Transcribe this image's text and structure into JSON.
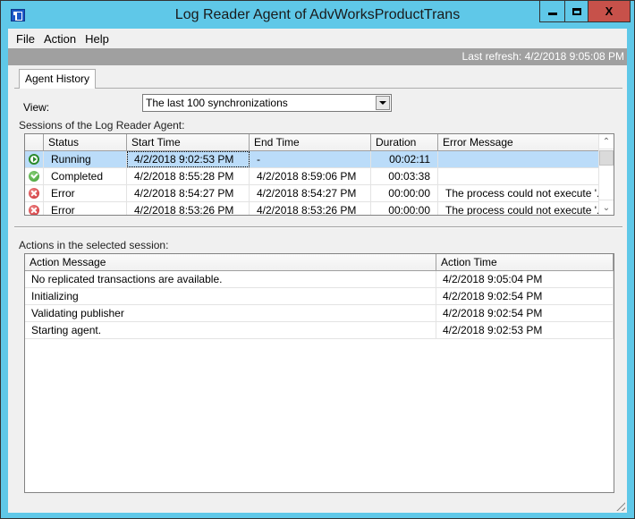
{
  "window": {
    "title": "Log Reader Agent of AdvWorksProductTrans",
    "buttons": {
      "minimize": "minimize",
      "maximize": "maximize",
      "close": "X"
    }
  },
  "menu": {
    "items": [
      {
        "label": "File"
      },
      {
        "label": "Action"
      },
      {
        "label": "Help"
      }
    ]
  },
  "refresh_bar": {
    "text": "Last refresh: 4/2/2018 9:05:08 PM"
  },
  "tabs": [
    {
      "label": "Agent History",
      "active": true
    }
  ],
  "view": {
    "label": "View:",
    "selected": "The last 100 synchronizations"
  },
  "sessions": {
    "label": "Sessions of the Log Reader Agent:",
    "columns": [
      "",
      "Status",
      "Start Time",
      "End Time",
      "Duration",
      "Error Message"
    ],
    "rows": [
      {
        "icon": "running-icon",
        "status": "Running",
        "start": "4/2/2018 9:02:53 PM",
        "end": "-",
        "duration": "00:02:11",
        "error": "",
        "selected": true
      },
      {
        "icon": "completed-icon",
        "status": "Completed",
        "start": "4/2/2018 8:55:28 PM",
        "end": "4/2/2018 8:59:06 PM",
        "duration": "00:03:38",
        "error": ""
      },
      {
        "icon": "error-icon",
        "status": "Error",
        "start": "4/2/2018 8:54:27 PM",
        "end": "4/2/2018 8:54:27 PM",
        "duration": "00:00:00",
        "error": "The process could not execute '..."
      },
      {
        "icon": "error-icon",
        "status": "Error",
        "start": "4/2/2018 8:53:26 PM",
        "end": "4/2/2018 8:53:26 PM",
        "duration": "00:00:00",
        "error": "The process could not execute '..."
      }
    ],
    "scroll_up": "^",
    "scroll_down": "v"
  },
  "actions": {
    "label": "Actions in the selected session:",
    "columns": [
      "Action Message",
      "Action Time"
    ],
    "rows": [
      {
        "message": "No replicated transactions are available.",
        "time": "4/2/2018 9:05:04 PM"
      },
      {
        "message": "Initializing",
        "time": "4/2/2018 9:02:54 PM"
      },
      {
        "message": "Validating publisher",
        "time": "4/2/2018 9:02:54 PM"
      },
      {
        "message": "Starting agent.",
        "time": "4/2/2018 9:02:53 PM"
      }
    ]
  }
}
